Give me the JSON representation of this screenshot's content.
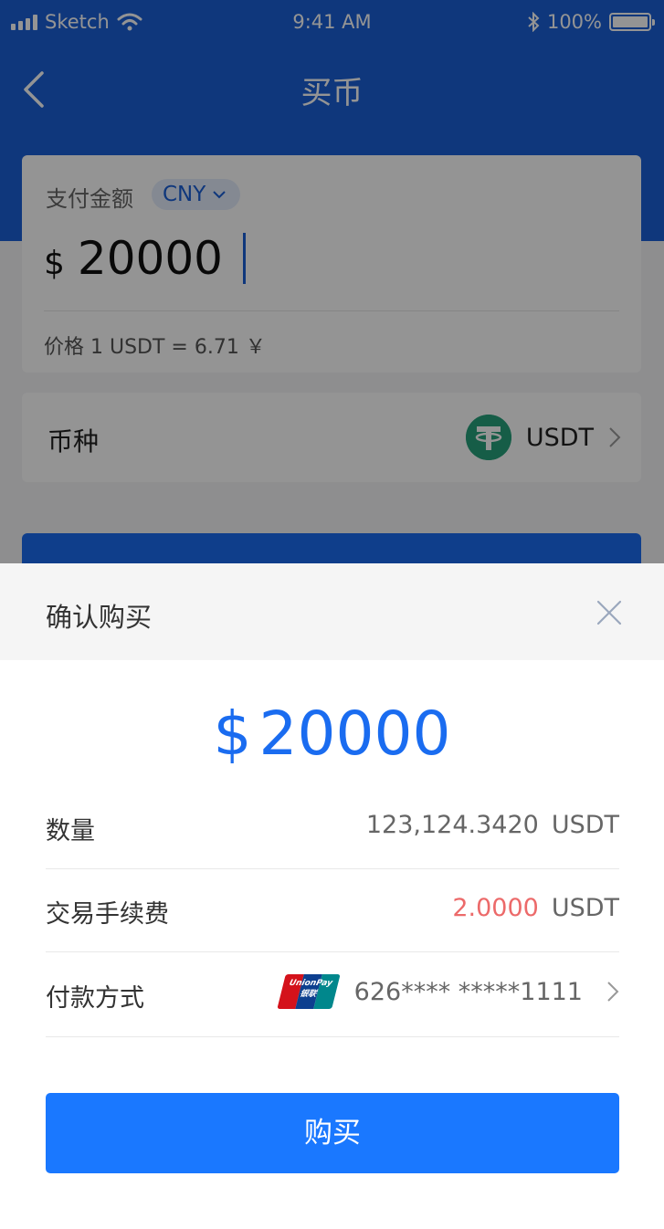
{
  "status_bar": {
    "carrier": "Sketch",
    "time": "9:41 AM",
    "battery": "100%"
  },
  "nav": {
    "title": "买币"
  },
  "pay_card": {
    "label": "支付金额",
    "currency": "CNY",
    "amount_symbol": "$",
    "amount": "20000",
    "price_line": "价格  1 USDT = 6.71 ￥"
  },
  "coin_card": {
    "label": "币种",
    "coin": "USDT"
  },
  "modal": {
    "title": "确认购买",
    "amount_symbol": "$",
    "amount": "20000",
    "rows": {
      "quantity": {
        "label": "数量",
        "value": "123,124.3420",
        "unit": "USDT"
      },
      "fee": {
        "label": "交易手续费",
        "value": "2.0000",
        "unit": "USDT"
      },
      "payment": {
        "label": "付款方式",
        "card_number": "626**** *****1111",
        "card_brand": "UnionPay",
        "card_brand_cn": "银联"
      }
    },
    "buy_label": "购买"
  },
  "colors": {
    "brand_blue": "#1a5fd6",
    "button_blue": "#1a78ff",
    "fee_red": "#ec6a6a",
    "tether_green": "#26a17b"
  }
}
